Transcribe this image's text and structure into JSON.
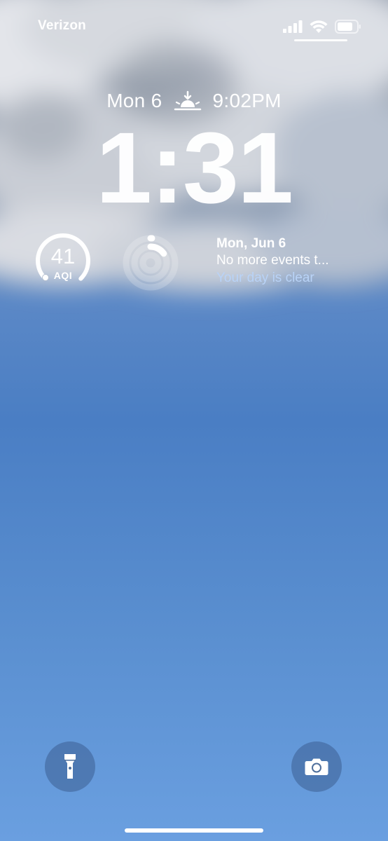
{
  "status_bar": {
    "carrier": "Verizon",
    "icons": [
      "cellular-signal-icon",
      "wifi-icon",
      "battery-icon"
    ]
  },
  "lock_screen": {
    "date": "Mon 6",
    "sunset_icon": "sunset-icon",
    "sunset_time": "9:02PM",
    "time": "1:31"
  },
  "widgets": {
    "aqi": {
      "value": "41",
      "label": "AQI",
      "gauge_level": 0.41
    },
    "activity": {
      "icon": "activity-rings-icon"
    },
    "calendar": {
      "date": "Mon, Jun 6",
      "event": "No more events t...",
      "status": "Your day is clear",
      "status_color": "#b9d3f7"
    }
  },
  "controls": {
    "flashlight": "flashlight-icon",
    "camera": "camera-icon"
  }
}
